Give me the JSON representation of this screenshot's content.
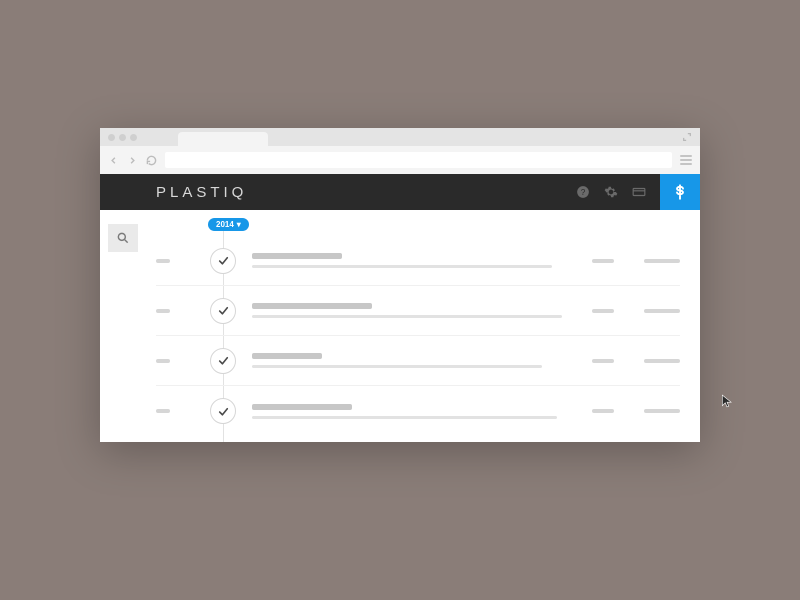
{
  "browser": {
    "tab_title": "",
    "address": ""
  },
  "app": {
    "brand": "PLASTIQ",
    "header_icons": [
      "help-icon",
      "gear-icon",
      "card-icon"
    ],
    "pay_icon": "dollar-icon"
  },
  "timeline": {
    "year_label": "2014",
    "rows": [
      {
        "title_width": 90,
        "sub_width": 300,
        "r1_width": 22,
        "r2_width": 36
      },
      {
        "title_width": 120,
        "sub_width": 310,
        "r1_width": 22,
        "r2_width": 36
      },
      {
        "title_width": 70,
        "sub_width": 290,
        "r1_width": 22,
        "r2_width": 36
      },
      {
        "title_width": 100,
        "sub_width": 305,
        "r1_width": 22,
        "r2_width": 36
      }
    ]
  },
  "colors": {
    "accent": "#1797e8",
    "dark": "#2a2a2a"
  }
}
